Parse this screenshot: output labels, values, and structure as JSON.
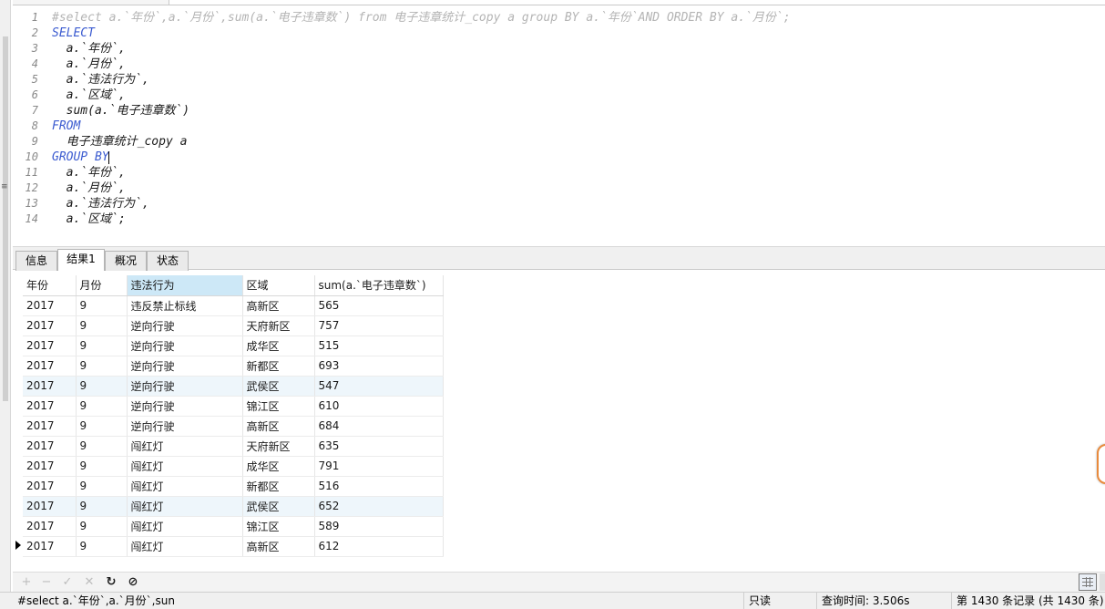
{
  "editor": {
    "lines": [
      {
        "num": "1",
        "text": "#select a.`年份`,a.`月份`,sum(a.`电子违章数`) from 电子违章统计_copy a group BY a.`年份`AND ORDER BY a.`月份`;",
        "kind": "comment"
      },
      {
        "num": "2",
        "text": "SELECT",
        "kind": "kw"
      },
      {
        "num": "3",
        "text": "  a.`年份`,",
        "kind": "code"
      },
      {
        "num": "4",
        "text": "  a.`月份`,",
        "kind": "code"
      },
      {
        "num": "5",
        "text": "  a.`违法行为`,",
        "kind": "code"
      },
      {
        "num": "6",
        "text": "  a.`区域`,",
        "kind": "code"
      },
      {
        "num": "7",
        "text": "  sum(a.`电子违章数`)",
        "kind": "code"
      },
      {
        "num": "8",
        "text": "FROM",
        "kind": "kw"
      },
      {
        "num": "9",
        "text": "  电子违章统计_copy a",
        "kind": "code"
      },
      {
        "num": "10",
        "text": "GROUP BY",
        "kind": "kw"
      },
      {
        "num": "11",
        "text": "  a.`年份`,",
        "kind": "code"
      },
      {
        "num": "12",
        "text": "  a.`月份`,",
        "kind": "code"
      },
      {
        "num": "13",
        "text": "  a.`违法行为`,",
        "kind": "code"
      },
      {
        "num": "14",
        "text": "  a.`区域`;",
        "kind": "code"
      }
    ]
  },
  "result_tabs": [
    {
      "label": "信息"
    },
    {
      "label": "结果1"
    },
    {
      "label": "概况"
    },
    {
      "label": "状态"
    }
  ],
  "grid": {
    "columns": [
      "年份",
      "月份",
      "违法行为",
      "区域",
      "sum(a.`电子违章数`)"
    ],
    "rows": [
      [
        "2017",
        "9",
        "违反禁止标线",
        "高新区",
        "565"
      ],
      [
        "2017",
        "9",
        "逆向行驶",
        "天府新区",
        "757"
      ],
      [
        "2017",
        "9",
        "逆向行驶",
        "成华区",
        "515"
      ],
      [
        "2017",
        "9",
        "逆向行驶",
        "新都区",
        "693"
      ],
      [
        "2017",
        "9",
        "逆向行驶",
        "武侯区",
        "547"
      ],
      [
        "2017",
        "9",
        "逆向行驶",
        "锦江区",
        "610"
      ],
      [
        "2017",
        "9",
        "逆向行驶",
        "高新区",
        "684"
      ],
      [
        "2017",
        "9",
        "闯红灯",
        "天府新区",
        "635"
      ],
      [
        "2017",
        "9",
        "闯红灯",
        "成华区",
        "791"
      ],
      [
        "2017",
        "9",
        "闯红灯",
        "新都区",
        "516"
      ],
      [
        "2017",
        "9",
        "闯红灯",
        "武侯区",
        "652"
      ],
      [
        "2017",
        "9",
        "闯红灯",
        "锦江区",
        "589"
      ],
      [
        "2017",
        "9",
        "闯红灯",
        "高新区",
        "612"
      ]
    ]
  },
  "toolbar": {
    "add": "+",
    "remove": "−",
    "apply": "✓",
    "discard": "✕",
    "refresh": "↻",
    "stop": "⊘"
  },
  "status": {
    "query_text": "#select a.`年份`,a.`月份`,sun",
    "mode": "只读",
    "query_time": "查询时间: 3.506s",
    "records": "第 1430 条记录 (共 1430 条)"
  },
  "icons": {
    "add": "plus-icon",
    "remove": "minus-icon",
    "apply": "check-icon",
    "discard": "cross-icon",
    "refresh": "refresh-icon",
    "stop": "stop-icon",
    "grid_view": "grid-view-icon",
    "current_row": "current-row-arrow-icon"
  }
}
